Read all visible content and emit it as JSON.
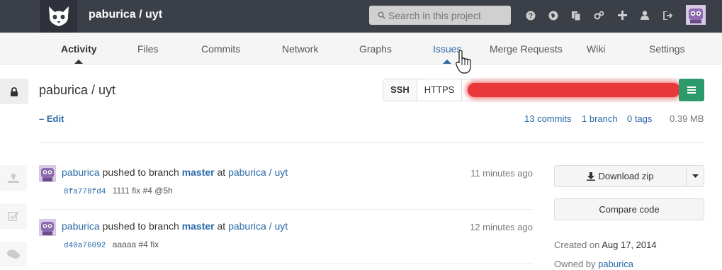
{
  "header": {
    "project_title": "paburica / uyt",
    "search_placeholder": "Search in this project",
    "icons": [
      "help-icon",
      "explore-icon",
      "snippets-icon",
      "admin-icon",
      "new-project-icon",
      "profile-icon",
      "logout-icon"
    ]
  },
  "nav": {
    "tabs": [
      {
        "label": "Activity"
      },
      {
        "label": "Files"
      },
      {
        "label": "Commits"
      },
      {
        "label": "Network"
      },
      {
        "label": "Graphs"
      },
      {
        "label": "Issues"
      },
      {
        "label": "Merge Requests"
      },
      {
        "label": "Wiki"
      },
      {
        "label": "Settings"
      }
    ],
    "active": "Activity",
    "hovered": "Issues"
  },
  "project": {
    "name": "paburica / uyt",
    "clone_ssh": "SSH",
    "clone_https": "HTTPS",
    "edit": "– Edit",
    "commits": "13 commits",
    "branches": "1 branch",
    "tags": "0 tags",
    "size": "0.39 MB"
  },
  "events": [
    {
      "author": "paburica",
      "action": "pushed to branch",
      "branch": "master",
      "at": "at",
      "project": "paburica / uyt",
      "time": "11 minutes ago",
      "sha": "8fa778fd4",
      "message": "1111 fix #4 @5h"
    },
    {
      "author": "paburica",
      "action": "pushed to branch",
      "branch": "master",
      "at": "at",
      "project": "paburica / uyt",
      "time": "12 minutes ago",
      "sha": "d40a76092",
      "message": "aaaaa #4 fix"
    }
  ],
  "sidebar": {
    "download_zip": "Download zip",
    "compare_code": "Compare code",
    "created_label": "Created on",
    "created_date": "Aug 17, 2014",
    "owned_label": "Owned by",
    "owner": "paburica"
  },
  "colors": {
    "header_bg": "#3b3f47",
    "link": "#2b6aa8",
    "accent_green": "#2d9a6c"
  }
}
